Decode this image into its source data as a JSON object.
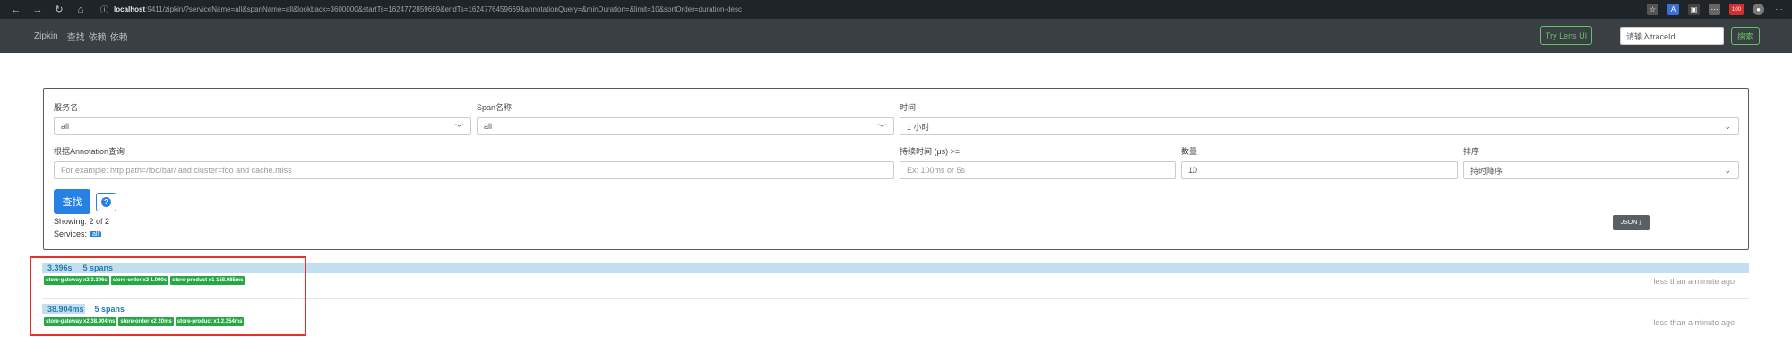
{
  "browser": {
    "url_prefix": "ⓘ",
    "url_host": "localhost",
    "url_rest": ":9411/zipkin/?serviceName=all&spanName=all&lookback=3600000&startTs=1624772859669&endTs=1624776459669&annotationQuery=&minDuration=&limit=10&sortOrder=duration-desc",
    "badge_count": "100"
  },
  "navbar": {
    "items": [
      "Zipkin",
      "查找",
      "依赖",
      "依赖"
    ],
    "try_lens": "Try Lens UI",
    "trace_placeholder": "请输入traceId",
    "search": "搜索"
  },
  "form": {
    "service_label": "服务名",
    "service_value": "all",
    "span_label": "Span名称",
    "span_value": "all",
    "time_label": "时间",
    "time_value": "1 小时",
    "annotation_label": "根据Annotation查询",
    "annotation_placeholder": "For example: http.path=/foo/bar/ and cluster=foo and cache.miss",
    "duration_label": "持续时间 (μs) >=",
    "duration_placeholder": "Ex: 100ms or 5s",
    "limit_label": "数量",
    "limit_value": "10",
    "sort_label": "排序",
    "sort_value": "持时降序",
    "find_button": "查找",
    "help_icon": "?",
    "showing": "Showing: 2 of 2",
    "services_label": "Services:",
    "services_badge": "all",
    "json_button": "JSON ⤓"
  },
  "traces": [
    {
      "duration": "3.396s",
      "spans": "5 spans",
      "bar_fraction": 1.0,
      "tags": [
        "store-gateway x2 3.396s",
        "store-order x2 1.090s",
        "store-product x1 158.085ms"
      ],
      "ago": "less than a minute ago"
    },
    {
      "duration": "38.904ms",
      "spans": "5 spans",
      "bar_fraction": 0.0115,
      "tags": [
        "store-gateway x2 38.904ms",
        "store-order x2 20ms",
        "store-product x1 2.354ms"
      ],
      "ago": "less than a minute ago"
    }
  ]
}
